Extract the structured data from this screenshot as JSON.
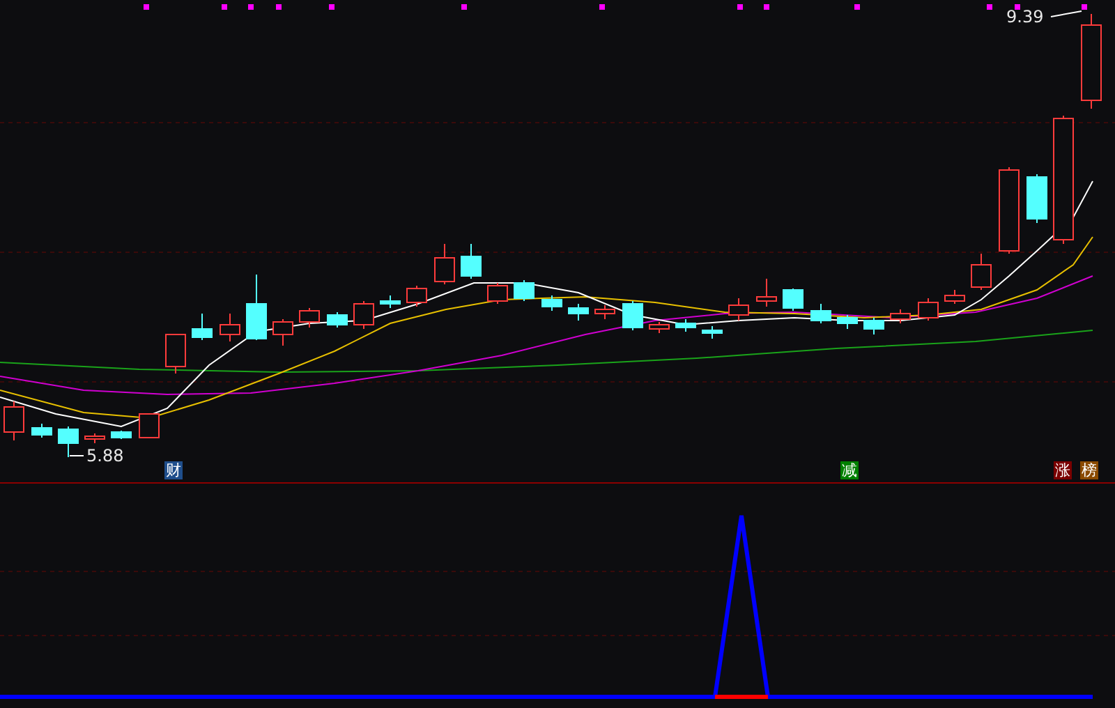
{
  "price_labels": {
    "high": "9.39",
    "low": "5.88"
  },
  "tags": [
    {
      "text": "财",
      "color": "#1f4e8c"
    },
    {
      "text": "减",
      "color": "#008000"
    },
    {
      "text": "涨",
      "color": "#7a0000"
    },
    {
      "text": "榜",
      "color": "#8a4a00"
    }
  ]
}
